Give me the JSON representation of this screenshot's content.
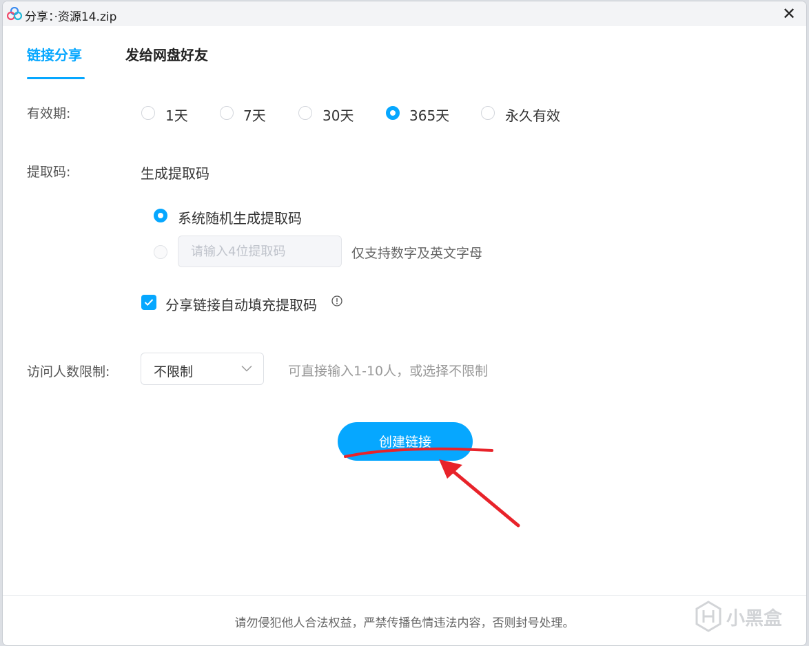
{
  "window": {
    "title": "分享：·资源14.zip",
    "close_glyph": "✕"
  },
  "tabs": [
    {
      "label": "链接分享",
      "active": true
    },
    {
      "label": "发给网盘好友",
      "active": false
    }
  ],
  "validity": {
    "label": "有效期:",
    "options": [
      {
        "label": "1天",
        "selected": false
      },
      {
        "label": "7天",
        "selected": false
      },
      {
        "label": "30天",
        "selected": false
      },
      {
        "label": "365天",
        "selected": true
      },
      {
        "label": "永久有效",
        "selected": false
      }
    ]
  },
  "extract_code": {
    "label": "提取码:",
    "subtitle": "生成提取码",
    "random_option": {
      "label": "系统随机生成提取码",
      "selected": true
    },
    "custom_option": {
      "selected": false,
      "disabled": true,
      "placeholder": "请输入4位提取码",
      "value": ""
    },
    "custom_hint": "仅支持数字及英文字母",
    "autofill": {
      "label": "分享链接自动填充提取码",
      "checked": true
    }
  },
  "visitor_limit": {
    "label": "访问人数限制:",
    "selected": "不限制",
    "hint": "可直接输入1-10人，或选择不限制"
  },
  "create_button": "创建链接",
  "footer": {
    "notice": "请勿侵犯他人合法权益，严禁传播色情违法内容，否则封号处理。",
    "watermark": "小黑盒"
  },
  "colors": {
    "accent": "#06a7ff",
    "annotation": "#e8232a"
  },
  "icons": [
    "app-logo-icon",
    "close-icon",
    "info-icon",
    "chevron-down-icon",
    "checkmark-icon",
    "xiaoheihe-watermark-icon"
  ]
}
